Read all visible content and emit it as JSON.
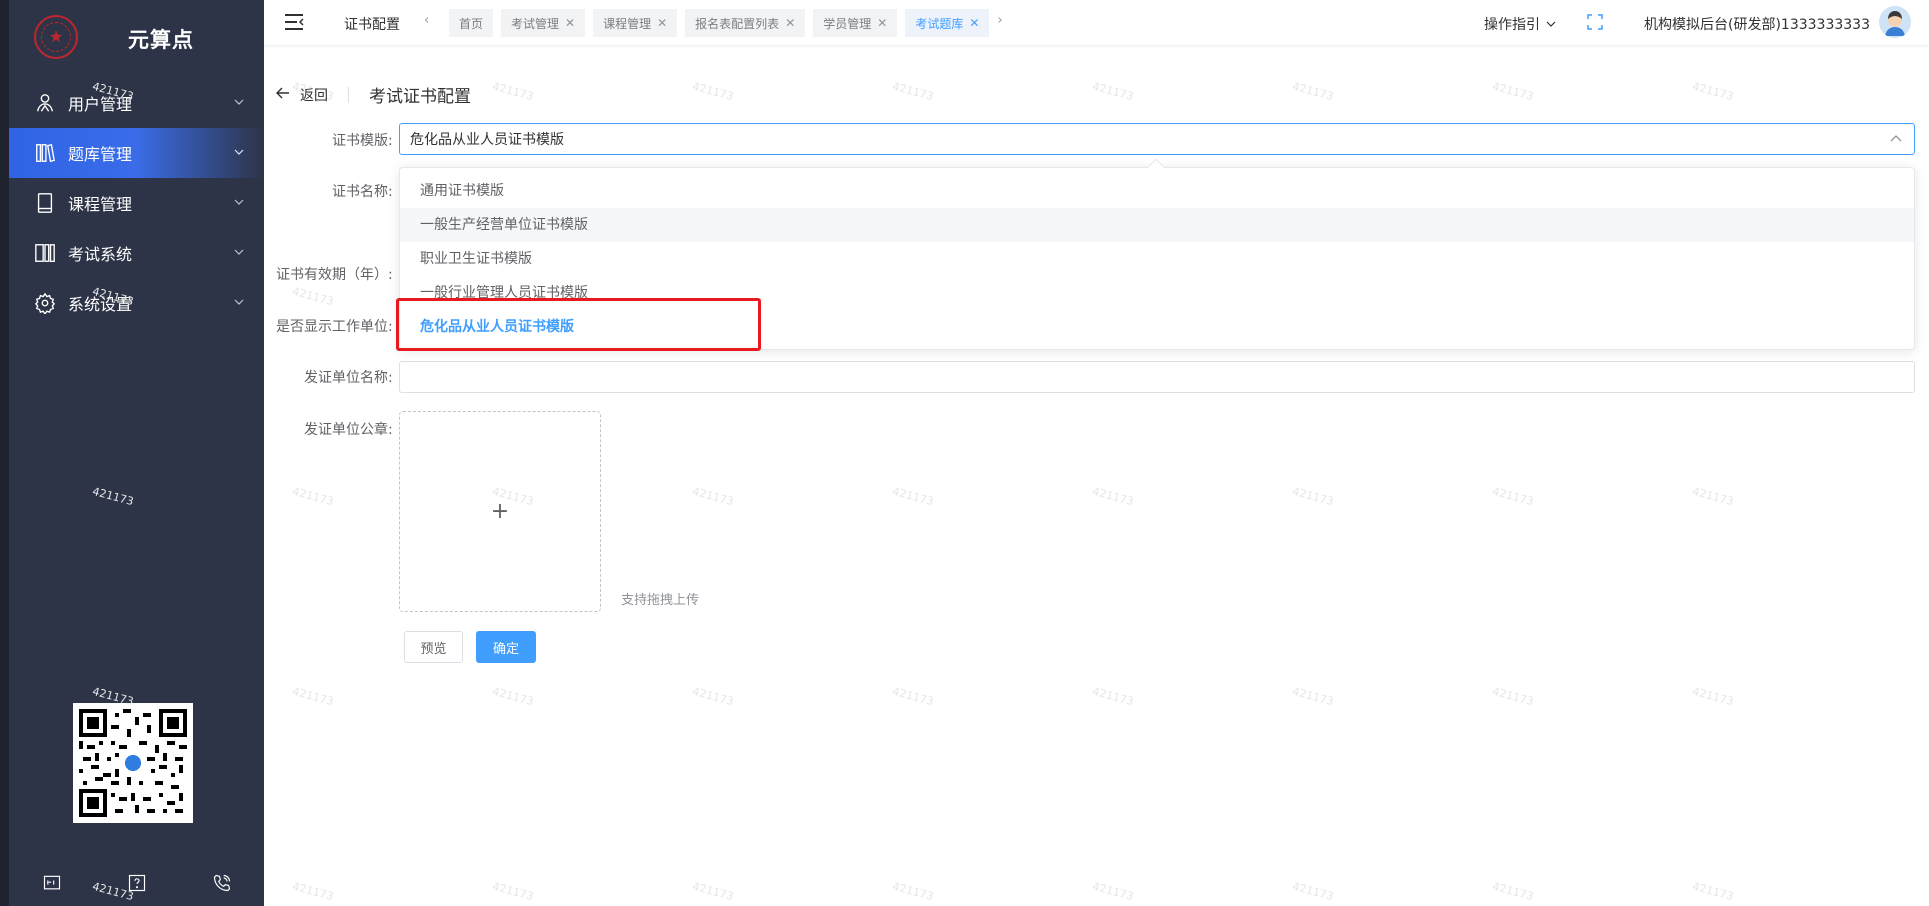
{
  "brand": {
    "name": "元算点"
  },
  "sidebar": {
    "items": [
      {
        "label": "用户管理",
        "icon": "user-group-icon",
        "active": false
      },
      {
        "label": "题库管理",
        "icon": "library-icon",
        "active": true
      },
      {
        "label": "课程管理",
        "icon": "book-icon",
        "active": false
      },
      {
        "label": "考试系统",
        "icon": "exam-icon",
        "active": false
      },
      {
        "label": "系统设置",
        "icon": "gear-icon",
        "active": false
      }
    ],
    "footer_icons": [
      "screen-icon",
      "help-icon",
      "phone-icon"
    ]
  },
  "topbar": {
    "title": "证书配置",
    "tabs": [
      {
        "label": "首页",
        "closable": false,
        "active": false
      },
      {
        "label": "考试管理",
        "closable": true,
        "active": false
      },
      {
        "label": "课程管理",
        "closable": true,
        "active": false
      },
      {
        "label": "报名表配置列表",
        "closable": true,
        "active": false
      },
      {
        "label": "学员管理",
        "closable": true,
        "active": false
      },
      {
        "label": "考试题库",
        "closable": true,
        "active": true
      }
    ],
    "guide": "操作指引",
    "user": "机构模拟后台(研发部)1333333333"
  },
  "page": {
    "back": "返回",
    "title": "考试证书配置"
  },
  "form": {
    "template_label": "证书模版:",
    "template_value": "危化品从业人员证书模版",
    "name_label": "证书名称:",
    "validity_label": "证书有效期（年）:",
    "show_unit_label": "是否显示工作单位:",
    "issuer_label": "发证单位名称:",
    "seal_label": "发证单位公章:",
    "upload_plus": "+",
    "upload_tip": "支持拖拽上传",
    "preview_button": "预览",
    "confirm_button": "确定"
  },
  "dropdown": {
    "options": [
      "通用证书模版",
      "一般生产经营单位证书模版",
      "职业卫生证书模版",
      "一般行业管理人员证书模版",
      "危化品从业人员证书模版"
    ],
    "hovered_index": 1,
    "selected_index": 4
  },
  "watermark": "421173",
  "colors": {
    "accent": "#409eff",
    "sidebar": "#2e3447",
    "highlight": "#e8191f"
  }
}
